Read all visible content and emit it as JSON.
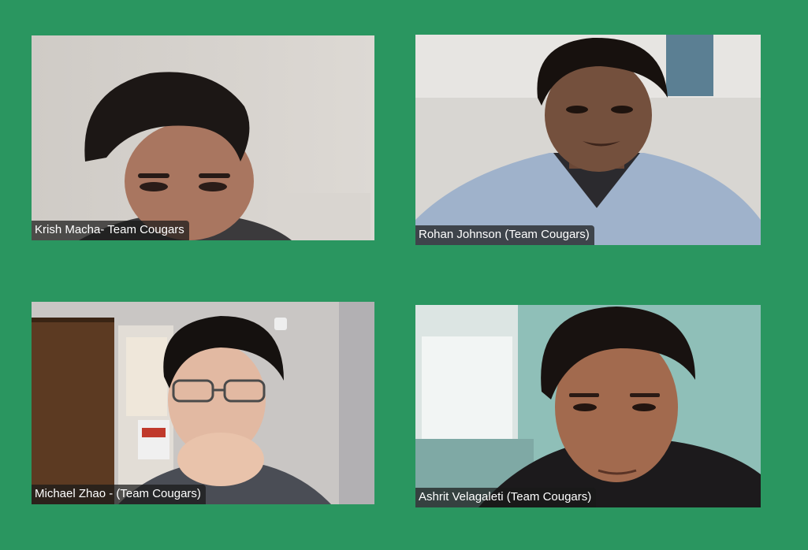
{
  "colors": {
    "background": "#2a9660",
    "label_background": "#191919",
    "label_text": "#ffffff"
  },
  "participants": [
    {
      "name": "Krish Macha- Team Cougars"
    },
    {
      "name": "Rohan Johnson (Team Cougars)"
    },
    {
      "name": "Michael Zhao - (Team Cougars)"
    },
    {
      "name": "Ashrit Velagaleti (Team Cougars)"
    }
  ]
}
